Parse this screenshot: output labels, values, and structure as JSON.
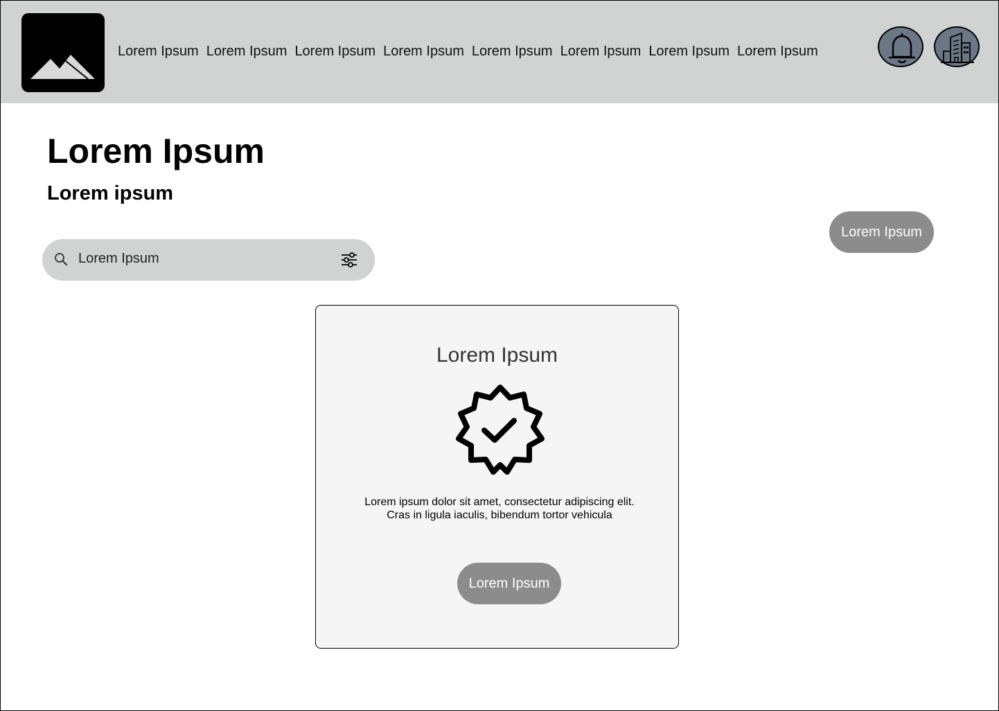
{
  "header": {
    "logo_icon": "image-placeholder-icon",
    "nav_items": [
      {
        "label": "Lorem Ipsum"
      },
      {
        "label": "Lorem Ipsum"
      },
      {
        "label": "Lorem Ipsum"
      },
      {
        "label": "Lorem Ipsum"
      },
      {
        "label": "Lorem Ipsum"
      },
      {
        "label": "Lorem Ipsum"
      },
      {
        "label": "Lorem Ipsum"
      },
      {
        "label": "Lorem Ipsum"
      }
    ],
    "notification_icon": "bell-icon",
    "organization_icon": "building-icon"
  },
  "main": {
    "title": "Lorem Ipsum",
    "subtitle": "Lorem ipsum",
    "action_button_label": "Lorem Ipsum",
    "search": {
      "value": "Lorem Ipsum",
      "icon": "search-icon",
      "filter_icon": "sliders-icon"
    }
  },
  "card": {
    "title": "Lorem Ipsum",
    "icon": "verified-badge-icon",
    "text_line1": "Lorem ipsum dolor sit amet, consectetur adipiscing elit.",
    "text_line2": "Cras in ligula iaculis, bibendum tortor vehicula",
    "button_label": "Lorem Ipsum"
  },
  "colors": {
    "header_bg": "#d0d3d2",
    "button_bg": "#8c8c8c",
    "icon_button_bg": "#6b7785",
    "card_bg": "#f5f5f5"
  }
}
